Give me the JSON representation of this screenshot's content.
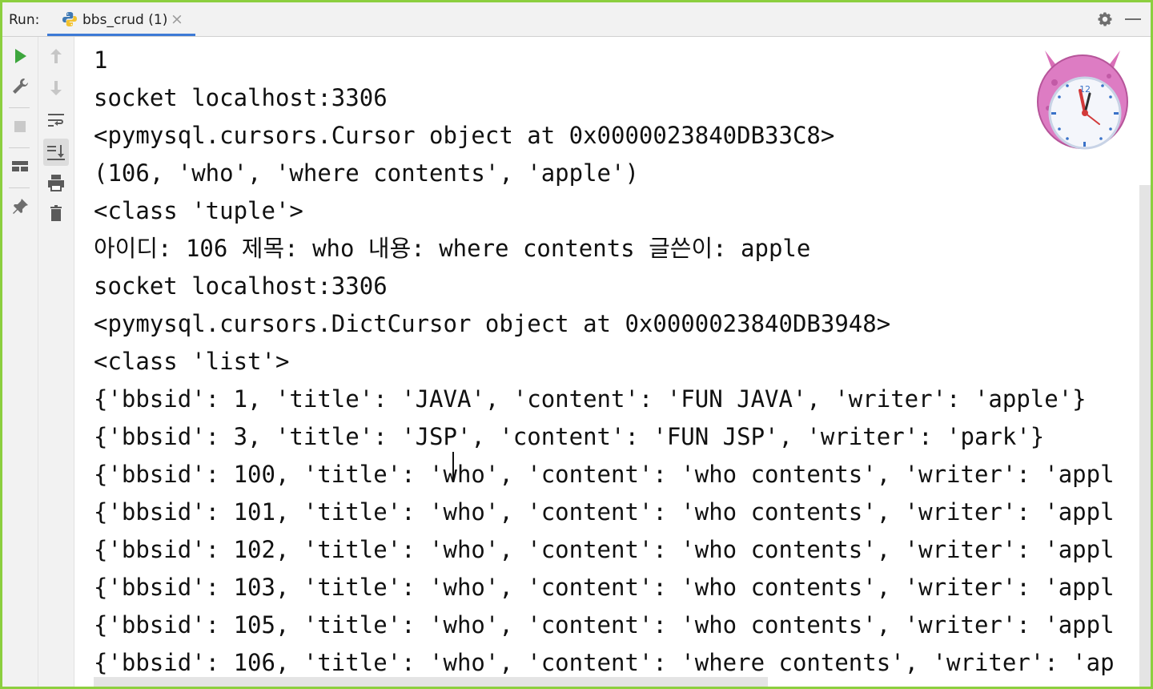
{
  "header": {
    "run_label": "Run:",
    "tab_label": "bbs_crud (1)",
    "tab_close": "×"
  },
  "console": {
    "lines": [
      "1",
      "socket localhost:3306",
      "<pymysql.cursors.Cursor object at 0x0000023840DB33C8>",
      "(106, 'who', 'where contents', 'apple')",
      "<class 'tuple'>",
      "아이디: 106 제목: who 내용: where contents 글쓴이: apple",
      "socket localhost:3306",
      "<pymysql.cursors.DictCursor object at 0x0000023840DB3948>",
      "<class 'list'>",
      "{'bbsid': 1, 'title': 'JAVA', 'content': 'FUN JAVA', 'writer': 'apple'}",
      "{'bbsid': 3, 'title': 'JSP', 'content': 'FUN JSP', 'writer': 'park'}",
      "{'bbsid': 100, 'title': 'who', 'content': 'who contents', 'writer': 'appl",
      "{'bbsid': 101, 'title': 'who', 'content': 'who contents', 'writer': 'appl",
      "{'bbsid': 102, 'title': 'who', 'content': 'who contents', 'writer': 'appl",
      "{'bbsid': 103, 'title': 'who', 'content': 'who contents', 'writer': 'appl",
      "{'bbsid': 105, 'title': 'who', 'content': 'who contents', 'writer': 'appl",
      "{'bbsid': 106, 'title': 'who', 'content': 'where contents', 'writer': 'ap"
    ]
  },
  "icons": {
    "tab": "python-icon",
    "settings": "gear-icon",
    "minimize": "minimize-icon",
    "left_toolbar": [
      "run-icon",
      "wrench-icon",
      "stop-icon",
      "layout-icon",
      "pin-icon"
    ],
    "right_toolbar": [
      "up-arrow-icon",
      "down-arrow-icon",
      "soft-wrap-icon",
      "scroll-to-end-icon",
      "print-icon",
      "trash-icon"
    ],
    "overlay": "mascot-clock-icon"
  },
  "colors": {
    "frame_border": "#8ccf3f",
    "tab_underline": "#3d7ad6",
    "run_green": "#3da63d",
    "toolbar_bg": "#f2f2f2"
  }
}
